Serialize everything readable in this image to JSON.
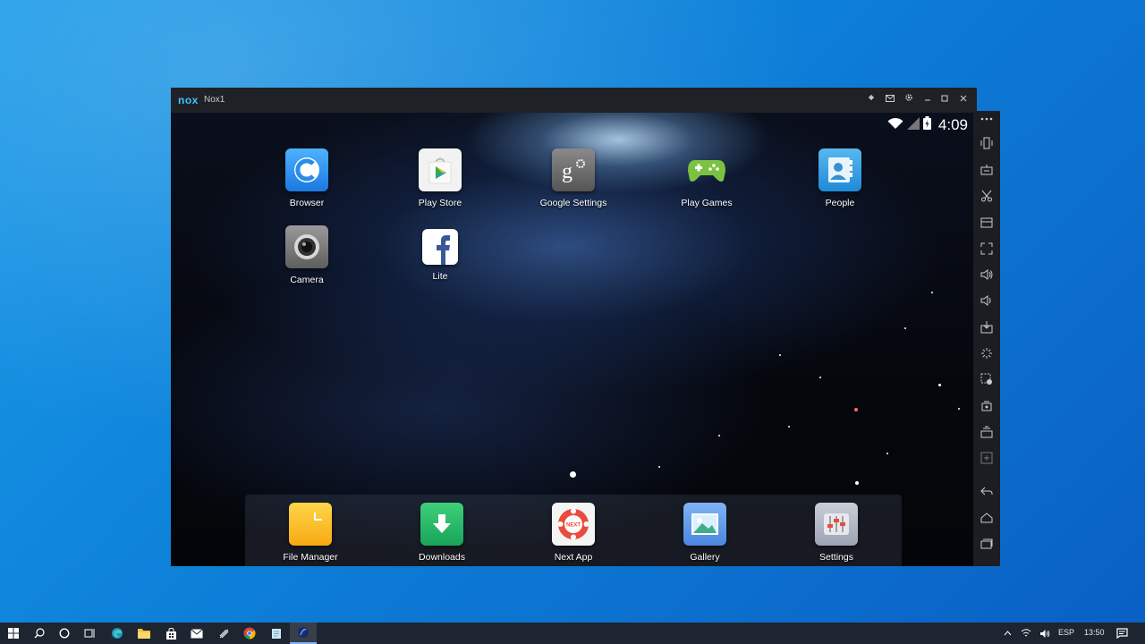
{
  "window": {
    "logo": "nox",
    "title": "Nox1"
  },
  "status_bar": {
    "time": "4:09",
    "icons": [
      "wifi-icon",
      "signal-icon",
      "battery-icon"
    ]
  },
  "home_apps": [
    {
      "label": "Browser",
      "icon": "browser-icon"
    },
    {
      "label": "Play Store",
      "icon": "play-store-icon"
    },
    {
      "label": "Google Settings",
      "icon": "google-settings-icon"
    },
    {
      "label": "Play Games",
      "icon": "play-games-icon"
    },
    {
      "label": "People",
      "icon": "people-icon"
    },
    {
      "label": "Camera",
      "icon": "camera-icon"
    },
    {
      "label": "Lite",
      "icon": "facebook-lite-icon"
    }
  ],
  "dock_apps": [
    {
      "label": "File Manager",
      "icon": "folder-icon"
    },
    {
      "label": "Downloads",
      "icon": "download-icon"
    },
    {
      "label": "Next App",
      "icon": "next-app-icon"
    },
    {
      "label": "Gallery",
      "icon": "gallery-icon"
    },
    {
      "label": "Settings",
      "icon": "settings-sliders-icon"
    }
  ],
  "side_toolbar": [
    "more-icon",
    "shake-icon",
    "keyboard-icon",
    "screenshot-scissors-icon",
    "multi-instance-icon",
    "fullscreen-icon",
    "volume-up-icon",
    "volume-down-icon",
    "apk-install-icon",
    "loading-icon",
    "macro-icon",
    "record-icon",
    "multi-drive-icon",
    "sync-icon",
    "back-icon",
    "home-icon",
    "recent-apps-icon"
  ],
  "taskbar": {
    "language": "ESP",
    "clock": "13:50",
    "apps": [
      "start-icon",
      "search-icon",
      "cortana-icon",
      "task-view-icon",
      "edge-icon",
      "file-explorer-icon",
      "store-icon",
      "mail-icon",
      "app-icon",
      "chrome-icon",
      "notes-icon",
      "nox-icon"
    ]
  },
  "colors": {
    "desktop": "#0d7fd8",
    "titlebar": "#1f2126",
    "taskbar": "#1c2530",
    "nox_accent": "#38c5ff"
  }
}
